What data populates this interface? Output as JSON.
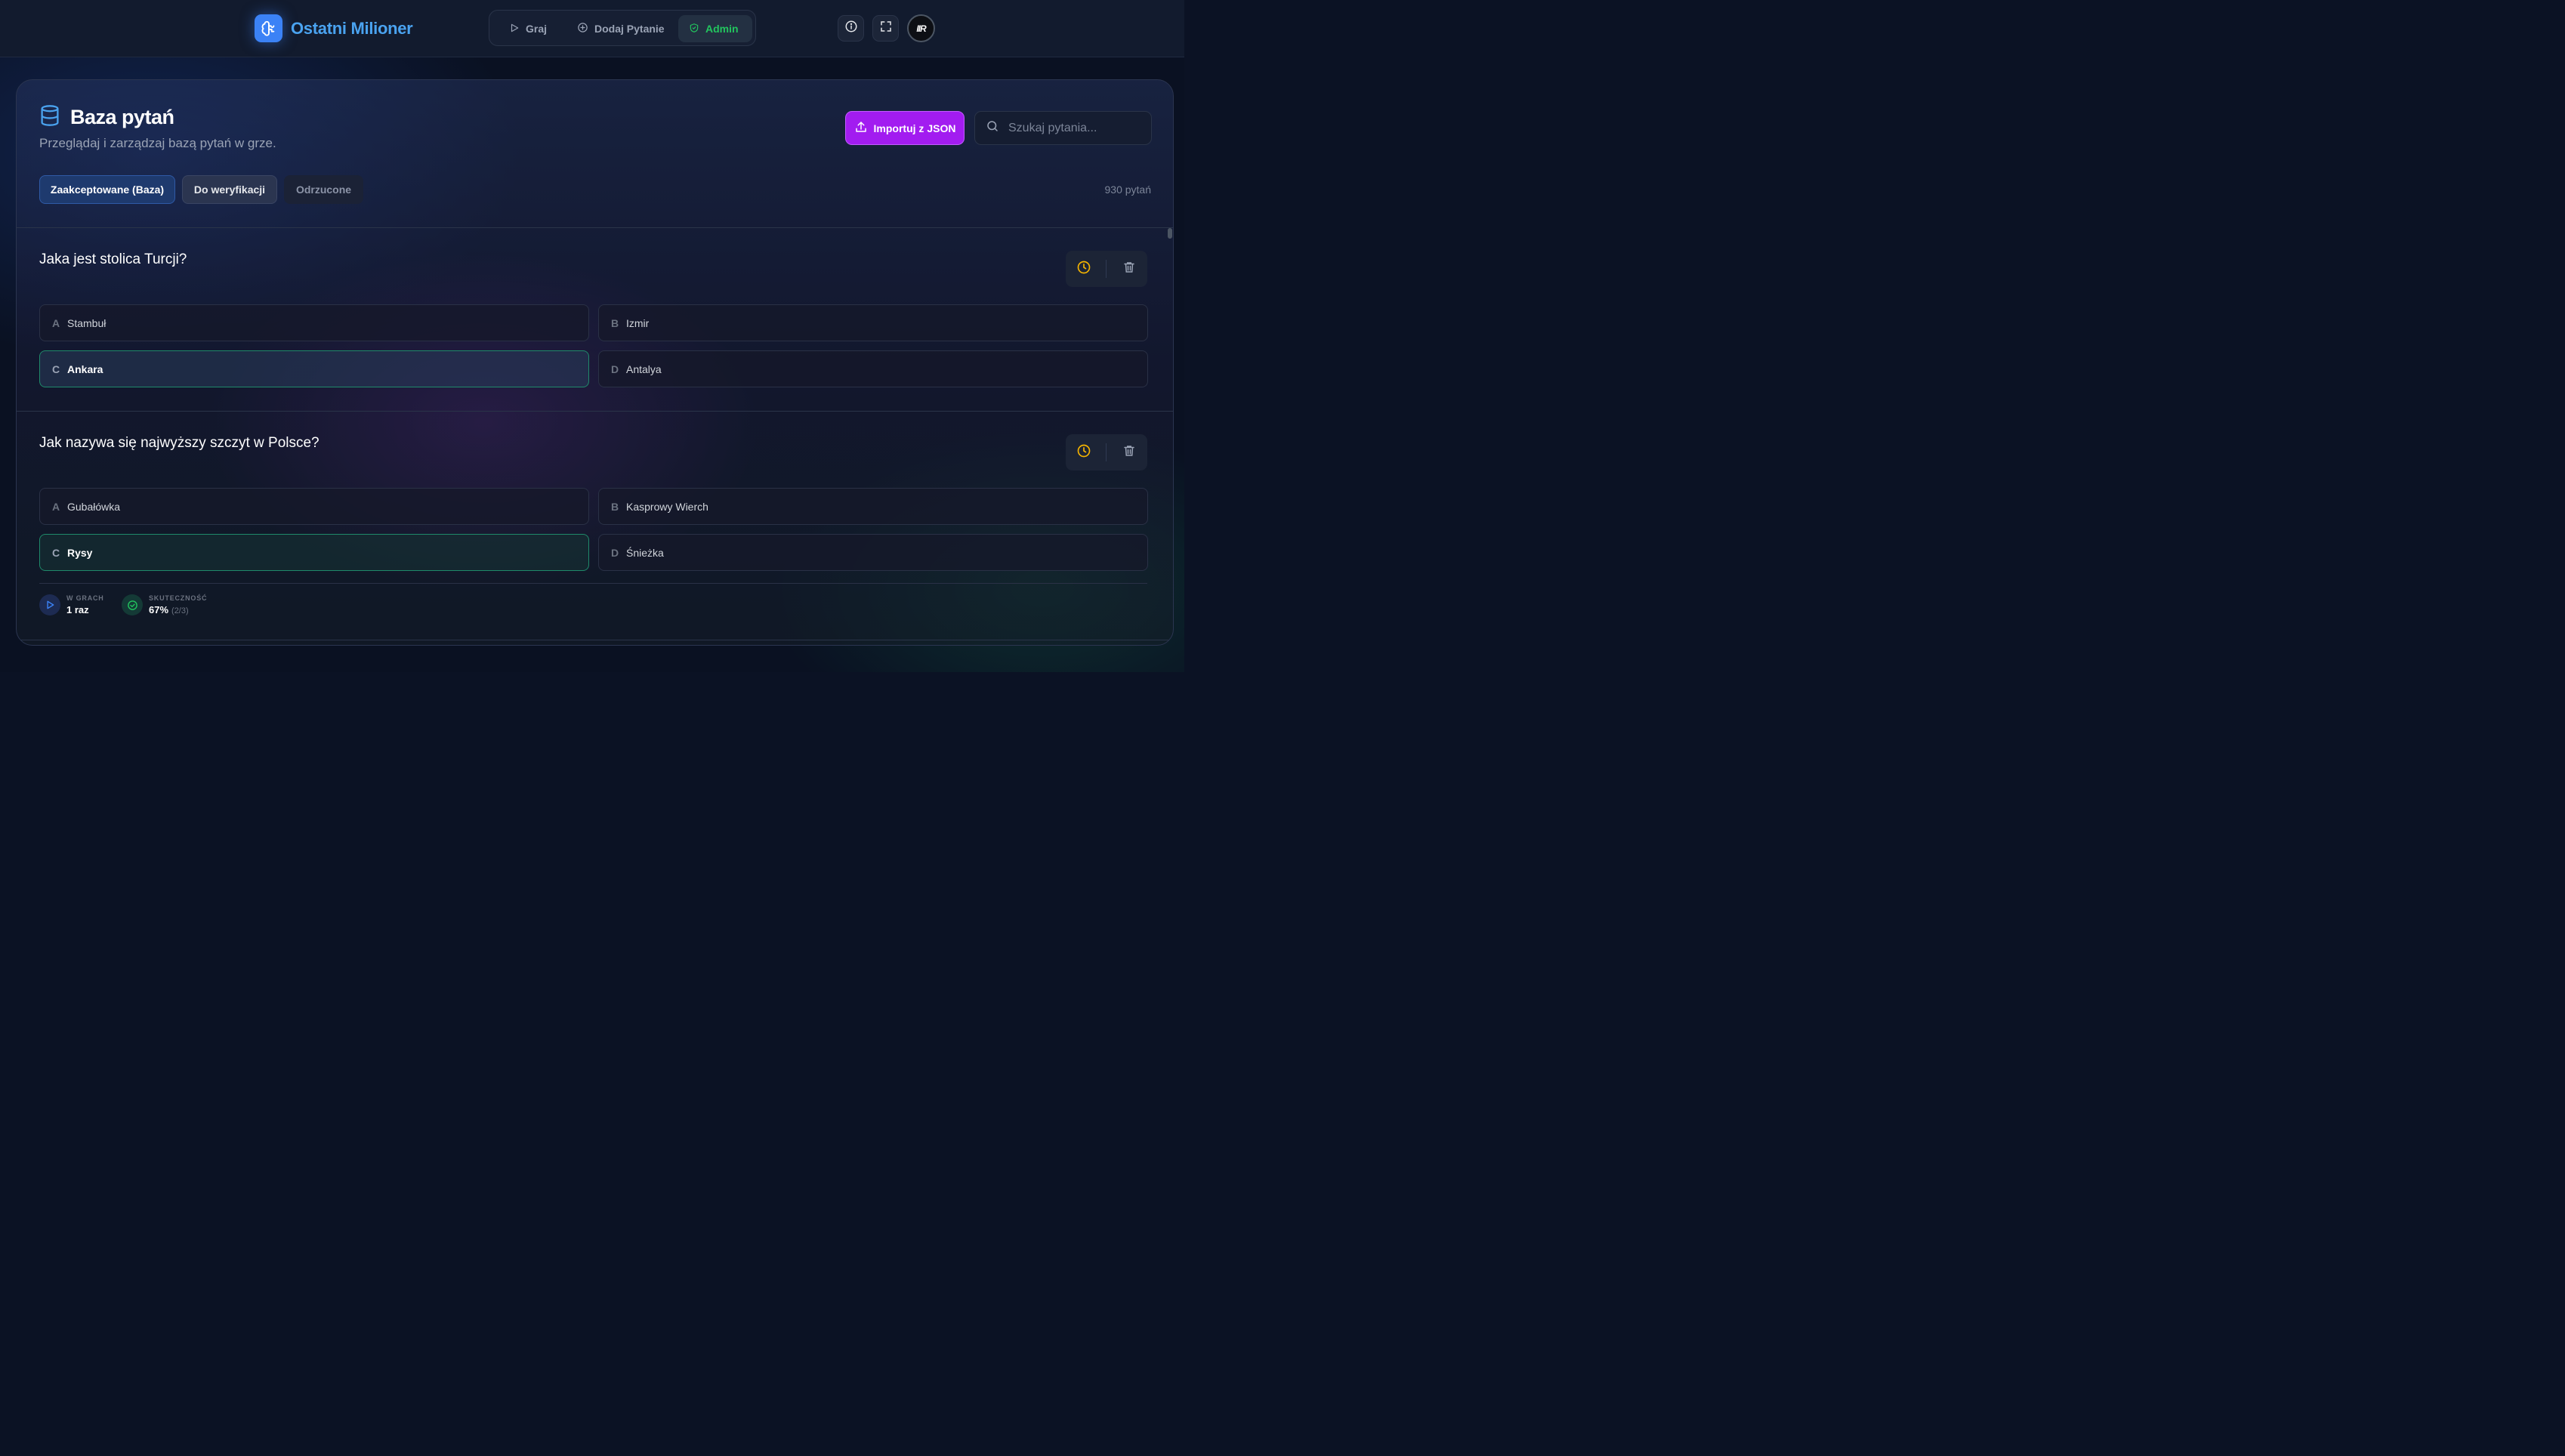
{
  "app": {
    "title": "Ostatni Milioner",
    "avatar_text": "IIR"
  },
  "nav": {
    "items": [
      {
        "label": "Graj",
        "icon": "play-icon"
      },
      {
        "label": "Dodaj Pytanie",
        "icon": "plus-circle-icon"
      },
      {
        "label": "Admin",
        "icon": "shield-icon",
        "active": true
      }
    ]
  },
  "header_icons": [
    "info-icon",
    "fullscreen-icon"
  ],
  "page": {
    "title": "Baza pytań",
    "subtitle": "Przeglądaj i zarządzaj bazą pytań w grze.",
    "import_label": "Importuj z JSON",
    "search_placeholder": "Szukaj pytania...",
    "tabs": [
      {
        "label": "Zaakceptowane (Baza)",
        "active": true
      },
      {
        "label": "Do weryfikacji"
      },
      {
        "label": "Odrzucone"
      }
    ],
    "count": "930 pytań"
  },
  "questions": [
    {
      "text": "Jaka jest stolica Turcji?",
      "answers": [
        {
          "letter": "A",
          "text": "Stambuł"
        },
        {
          "letter": "B",
          "text": "Izmir"
        },
        {
          "letter": "C",
          "text": "Ankara",
          "correct": true
        },
        {
          "letter": "D",
          "text": "Antalya"
        }
      ]
    },
    {
      "text": "Jak nazywa się najwyższy szczyt w Polsce?",
      "answers": [
        {
          "letter": "A",
          "text": "Gubałówka"
        },
        {
          "letter": "B",
          "text": "Kasprowy Wierch"
        },
        {
          "letter": "C",
          "text": "Rysy",
          "correct": true
        },
        {
          "letter": "D",
          "text": "Śnieżka"
        }
      ],
      "stats": {
        "games_label": "W GRACH",
        "games_value": "1 raz",
        "success_label": "SKUTECZNOŚĆ",
        "success_value": "67%",
        "success_detail": "(2/3)"
      }
    }
  ],
  "colors": {
    "accent_blue": "#3b82f6",
    "admin_green": "#22c55e",
    "import_purple": "#a21cf0",
    "clock_yellow": "#f5b400",
    "correct_border": "#1f8a6a"
  }
}
